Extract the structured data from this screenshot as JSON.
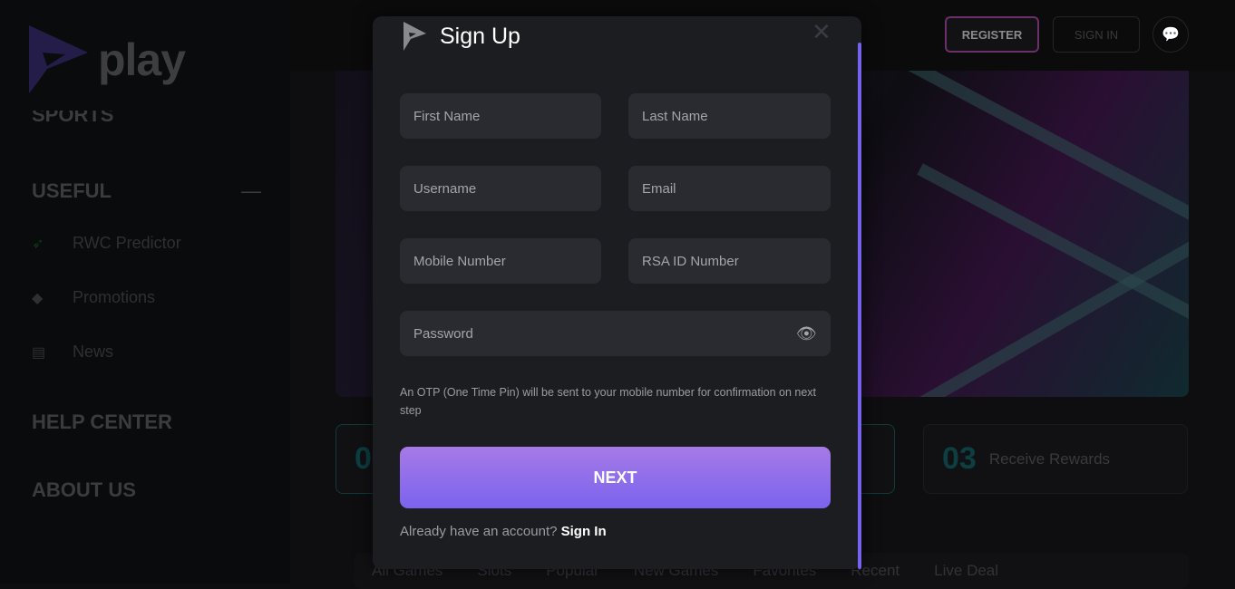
{
  "sidebar": {
    "logo_text": "play",
    "sports_label": "SPORTS",
    "useful_label": "USEFUL",
    "items": [
      {
        "label": "RWC Predictor",
        "icon": "springbok-icon"
      },
      {
        "label": "Promotions",
        "icon": "diamond-icon"
      },
      {
        "label": "News",
        "icon": "newspaper-icon"
      }
    ],
    "help_center": "HELP CENTER",
    "about_us": "ABOUT US"
  },
  "header": {
    "register": "REGISTER",
    "sign_in": "SIGN IN",
    "chat_icon": "chat-icon"
  },
  "steps": [
    {
      "num": "01",
      "label": ""
    },
    {
      "num": "03",
      "label": "Receive Rewards"
    }
  ],
  "tabs": [
    "All Games",
    "Slots",
    "Popular",
    "New Games",
    "Favorites",
    "Recent",
    "Live Deal"
  ],
  "modal": {
    "title": "Sign Up",
    "fields": {
      "first_name": "First Name",
      "last_name": "Last Name",
      "username": "Username",
      "email": "Email",
      "mobile": "Mobile Number",
      "rsa_id": "RSA ID Number",
      "password": "Password"
    },
    "otp_note": "An OTP (One Time Pin) will be sent to your mobile number for confirmation on next step",
    "next": "NEXT",
    "already": "Already have an account?",
    "sign_in": "Sign In",
    "accent": "#7b63ee"
  }
}
